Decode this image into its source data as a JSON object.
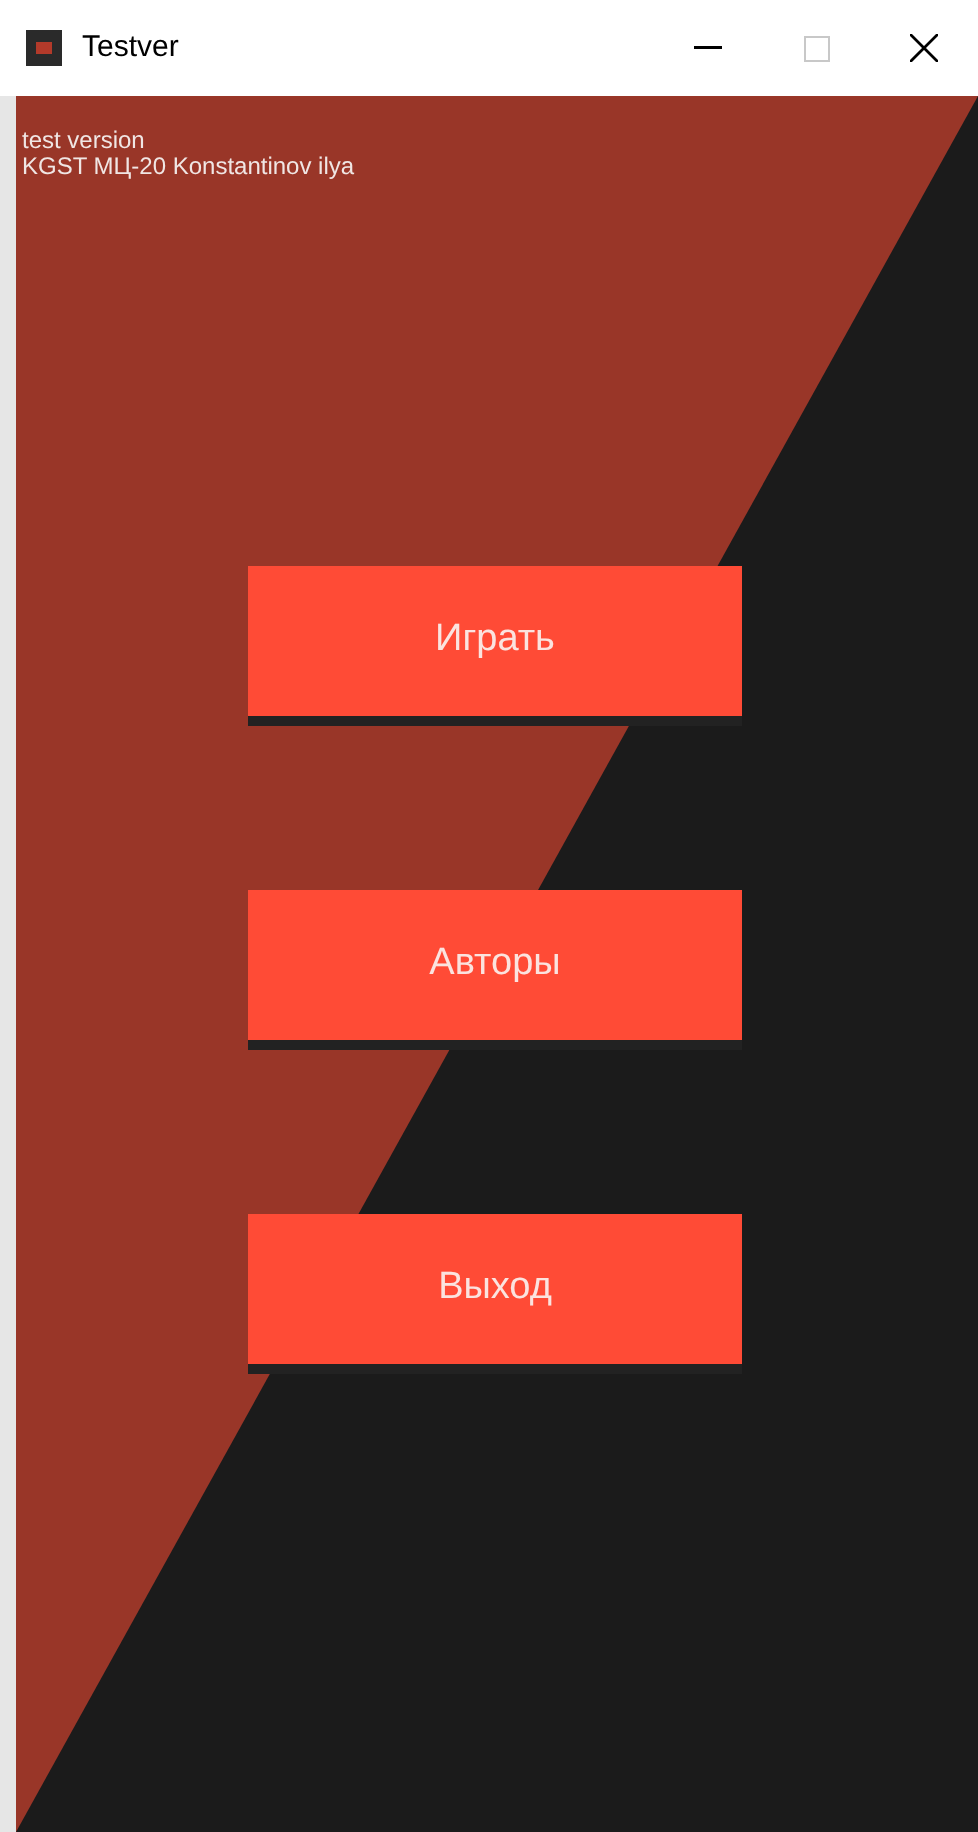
{
  "window": {
    "title": "Testver"
  },
  "info_lines": [
    "test version",
    "KGST МЦ-20 Konstantinov ilya"
  ],
  "buttons": [
    "Играть",
    "Авторы",
    "Выход"
  ]
}
